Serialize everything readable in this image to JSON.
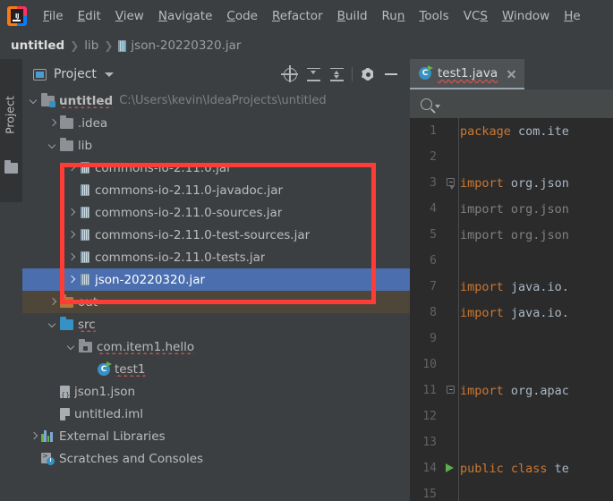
{
  "app": {
    "logo_text": "IJ",
    "menu": [
      {
        "name": "file",
        "label": "File",
        "mnemonic": "F"
      },
      {
        "name": "edit",
        "label": "Edit",
        "mnemonic": "E"
      },
      {
        "name": "view",
        "label": "View",
        "mnemonic": "V"
      },
      {
        "name": "navigate",
        "label": "Navigate",
        "mnemonic": "N"
      },
      {
        "name": "code",
        "label": "Code",
        "mnemonic": "C"
      },
      {
        "name": "refactor",
        "label": "Refactor",
        "mnemonic": "R"
      },
      {
        "name": "build",
        "label": "Build",
        "mnemonic": "B"
      },
      {
        "name": "run",
        "label": "Run",
        "mnemonic": "n"
      },
      {
        "name": "tools",
        "label": "Tools",
        "mnemonic": "T"
      },
      {
        "name": "vcs",
        "label": "VCS",
        "mnemonic": "S"
      },
      {
        "name": "window",
        "label": "Window",
        "mnemonic": "W"
      },
      {
        "name": "help",
        "label": "He",
        "mnemonic": "H"
      }
    ]
  },
  "breadcrumb": {
    "separator": "❯",
    "items": [
      {
        "label": "untitled",
        "strong": true,
        "icon": null
      },
      {
        "label": "lib",
        "strong": false,
        "icon": null
      },
      {
        "label": "json-20220320.jar",
        "strong": false,
        "icon": "jar-icon"
      }
    ]
  },
  "left_strip": {
    "tab_label": "Project",
    "folder_icon": "folder-icon"
  },
  "project_panel": {
    "title": "Project",
    "dropdown_icon": "chevron-down-icon",
    "window_icon": "project-window-icon",
    "tools": [
      {
        "name": "locate-in-tree-button",
        "icon": "locate-icon"
      },
      {
        "name": "expand-all-button",
        "icon": "expand-all-icon"
      },
      {
        "name": "collapse-all-button",
        "icon": "collapse-all-icon"
      },
      {
        "name": "settings-button",
        "icon": "gear-icon"
      },
      {
        "name": "hide-button",
        "icon": "minus-icon"
      }
    ],
    "tree": [
      {
        "label": "untitled",
        "path": "C:\\Users\\kevin\\IdeaProjects\\untitled",
        "indent": 0,
        "arrow": "down",
        "icon": "module-folder-icon",
        "wavy": true,
        "bold": true
      },
      {
        "label": ".idea",
        "path": "",
        "indent": 1,
        "arrow": "right",
        "icon": "folder-icon",
        "wavy": false,
        "bold": false
      },
      {
        "label": "lib",
        "path": "",
        "indent": 1,
        "arrow": "down",
        "icon": "folder-icon",
        "wavy": false,
        "bold": false
      },
      {
        "label": "commons-io-2.11.0.jar",
        "path": "",
        "indent": 2,
        "arrow": "right",
        "icon": "jar-icon",
        "wavy": false,
        "bold": false
      },
      {
        "label": "commons-io-2.11.0-javadoc.jar",
        "path": "",
        "indent": 2,
        "arrow": "none",
        "icon": "jar-icon",
        "wavy": false,
        "bold": false
      },
      {
        "label": "commons-io-2.11.0-sources.jar",
        "path": "",
        "indent": 2,
        "arrow": "right",
        "icon": "jar-icon",
        "wavy": false,
        "bold": false
      },
      {
        "label": "commons-io-2.11.0-test-sources.jar",
        "path": "",
        "indent": 2,
        "arrow": "right",
        "icon": "jar-icon",
        "wavy": false,
        "bold": false
      },
      {
        "label": "commons-io-2.11.0-tests.jar",
        "path": "",
        "indent": 2,
        "arrow": "right",
        "icon": "jar-icon",
        "wavy": false,
        "bold": false
      },
      {
        "label": "json-20220320.jar",
        "path": "",
        "indent": 2,
        "arrow": "right",
        "icon": "jar-icon",
        "wavy": false,
        "bold": false,
        "selected": true
      },
      {
        "label": "out",
        "path": "",
        "indent": 1,
        "arrow": "right",
        "icon": "excluded-folder-icon",
        "wavy": false,
        "bold": false,
        "excluded": true
      },
      {
        "label": "src",
        "path": "",
        "indent": 1,
        "arrow": "down",
        "icon": "source-folder-icon",
        "wavy": true,
        "bold": false
      },
      {
        "label": "com.item1.hello",
        "path": "",
        "indent": 2,
        "arrow": "down",
        "icon": "package-icon",
        "wavy": true,
        "bold": false
      },
      {
        "label": "test1",
        "path": "",
        "indent": 3,
        "arrow": "none",
        "icon": "java-class-icon",
        "wavy": true,
        "bold": false
      },
      {
        "label": "json1.json",
        "path": "",
        "indent": 1,
        "arrow": "none",
        "icon": "json-file-icon",
        "wavy": false,
        "bold": false
      },
      {
        "label": "untitled.iml",
        "path": "",
        "indent": 1,
        "arrow": "none",
        "icon": "iml-file-icon",
        "wavy": false,
        "bold": false
      },
      {
        "label": "External Libraries",
        "path": "",
        "indent": 0,
        "arrow": "right",
        "icon": "libraries-icon",
        "wavy": false,
        "bold": false
      },
      {
        "label": "Scratches and Consoles",
        "path": "",
        "indent": 0,
        "arrow": "none",
        "icon": "scratches-icon",
        "wavy": false,
        "bold": false
      }
    ]
  },
  "highlight": {
    "color": "#ff3c35",
    "shape": "rectangle"
  },
  "editor": {
    "tab": {
      "label": "test1.java",
      "icon": "java-class-icon",
      "close_icon": "close-icon"
    },
    "search": {
      "icon": "search-icon",
      "value": "",
      "placeholder": ""
    },
    "lines": [
      {
        "num": "1",
        "marker": "none",
        "segments": [
          {
            "t": "package ",
            "c": "kw"
          },
          {
            "t": "com.ite",
            "c": "plain"
          }
        ]
      },
      {
        "num": "2",
        "marker": "none",
        "segments": []
      },
      {
        "num": "3",
        "marker": "fold-tip",
        "segments": [
          {
            "t": "import ",
            "c": "kw"
          },
          {
            "t": "org.json",
            "c": "plain"
          }
        ]
      },
      {
        "num": "4",
        "marker": "none",
        "segments": [
          {
            "t": "import ",
            "c": "dim"
          },
          {
            "t": "org.json",
            "c": "dim"
          }
        ]
      },
      {
        "num": "5",
        "marker": "none",
        "segments": [
          {
            "t": "import ",
            "c": "dim"
          },
          {
            "t": "org.json",
            "c": "dim"
          }
        ]
      },
      {
        "num": "6",
        "marker": "none",
        "segments": []
      },
      {
        "num": "7",
        "marker": "none",
        "segments": [
          {
            "t": "import ",
            "c": "kw"
          },
          {
            "t": "java.io.",
            "c": "plain"
          }
        ]
      },
      {
        "num": "8",
        "marker": "none",
        "segments": [
          {
            "t": "import ",
            "c": "kw"
          },
          {
            "t": "java.io.",
            "c": "plain"
          }
        ]
      },
      {
        "num": "9",
        "marker": "none",
        "segments": []
      },
      {
        "num": "10",
        "marker": "none",
        "segments": []
      },
      {
        "num": "11",
        "marker": "fold",
        "segments": [
          {
            "t": "import ",
            "c": "kw"
          },
          {
            "t": "org.apac",
            "c": "plain"
          }
        ]
      },
      {
        "num": "12",
        "marker": "none",
        "segments": []
      },
      {
        "num": "13",
        "marker": "none",
        "segments": []
      },
      {
        "num": "14",
        "marker": "run",
        "segments": [
          {
            "t": "public class ",
            "c": "kw"
          },
          {
            "t": "te",
            "c": "plain"
          }
        ]
      },
      {
        "num": "15",
        "marker": "none",
        "segments": []
      }
    ]
  }
}
